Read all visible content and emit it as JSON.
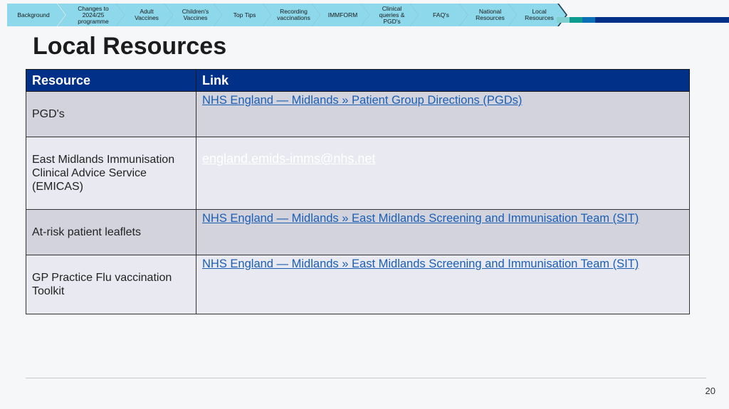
{
  "nav": {
    "items": [
      "Background",
      "Changes to 2024/25 programme",
      "Adult Vaccines",
      "Children's Vaccines",
      "Top Tips",
      "Recording vaccinations",
      "IMMFORM",
      "Clinical queries & PGD's",
      "FAQ's",
      "National Resources",
      "Local Resources"
    ],
    "accent_colors": [
      "#7fd0cf",
      "#0d9b8f",
      "#0a6fb3",
      "#003087"
    ]
  },
  "page": {
    "title": "Local Resources",
    "number": "20"
  },
  "table": {
    "headers": {
      "resource": "Resource",
      "link": "Link"
    },
    "rows": [
      {
        "resource": "PGD's",
        "link": "NHS England — Midlands » Patient Group Directions (PGDs)"
      },
      {
        "resource": "East Midlands Immunisation Clinical Advice Service (EMICAS)",
        "link": "england.emids-imms@nhs.net"
      },
      {
        "resource": "At-risk patient leaflets",
        "link": "NHS England — Midlands » East Midlands Screening and Immunisation Team (SIT)"
      },
      {
        "resource": "GP Practice Flu vaccination Toolkit",
        "link": "NHS England — Midlands » East Midlands Screening and Immunisation Team (SIT)"
      }
    ]
  },
  "colors": {
    "header_bg": "#003087",
    "link": "#1a5fb4",
    "nav_bg": "#8dd8eb"
  }
}
